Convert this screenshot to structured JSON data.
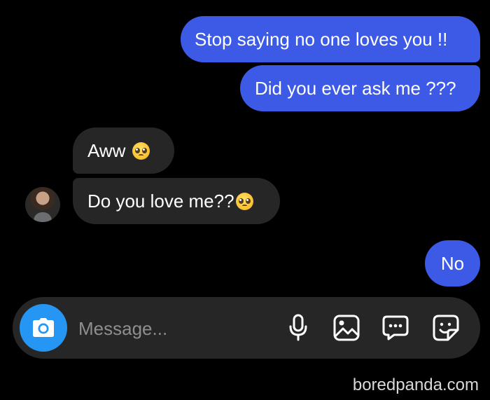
{
  "messages": [
    {
      "text": "Stop saying no one loves you !!"
    },
    {
      "text": "Did you ever ask me ???"
    },
    {
      "text": "Aww"
    },
    {
      "text": "Do you love me??"
    },
    {
      "text": "No"
    }
  ],
  "composer": {
    "placeholder": "Message..."
  },
  "icons": {
    "camera": "camera-icon",
    "mic": "microphone-icon",
    "gallery": "gallery-icon",
    "chat": "chat-bubble-icon",
    "sticker": "sticker-icon",
    "emoji": "pleading-face-emoji"
  },
  "colors": {
    "outgoing": "#3d5ae6",
    "incoming": "#262626",
    "camera_button": "#2596f3",
    "background": "#000000"
  },
  "watermark": "boredpanda.com"
}
